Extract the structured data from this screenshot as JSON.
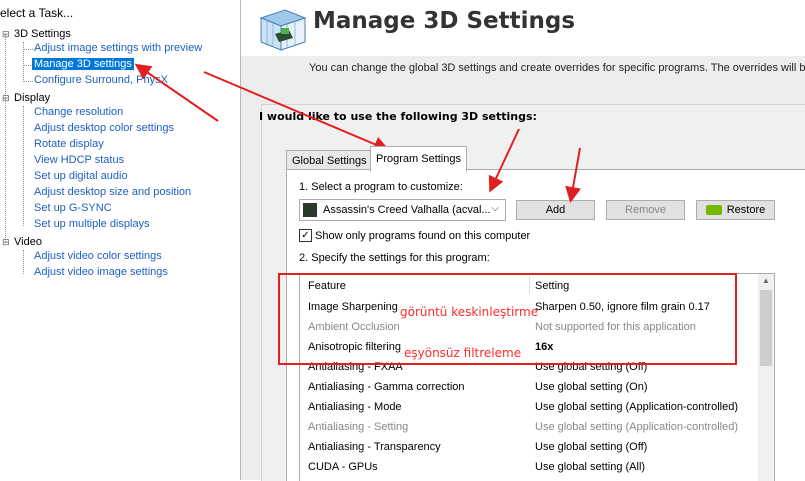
{
  "left_panel": {
    "task_title": "elect a Task...",
    "categories": [
      {
        "label": "3D Settings",
        "items": [
          "Adjust image settings with preview",
          "Manage 3D settings",
          "Configure Surround, PhysX"
        ]
      },
      {
        "label": "Display",
        "items": [
          "Change resolution",
          "Adjust desktop color settings",
          "Rotate display",
          "View HDCP status",
          "Set up digital audio",
          "Adjust desktop size and position",
          "Set up G-SYNC",
          "Set up multiple displays"
        ]
      },
      {
        "label": "Video",
        "items": [
          "Adjust video color settings",
          "Adjust video image settings"
        ]
      }
    ],
    "selected_item": "Manage 3D settings"
  },
  "header": {
    "title": "Manage 3D Settings",
    "description": "You can change the global 3D settings and create overrides for specific programs. The overrides will be u"
  },
  "panel": {
    "title": "I would like to use the following 3D settings:",
    "tabs": [
      "Global Settings",
      "Program Settings"
    ],
    "active_tab": "Program Settings",
    "step1_label": "1. Select a program to customize:",
    "program_value": "Assassin's Creed Valhalla (acval...",
    "add_label": "Add",
    "remove_label": "Remove",
    "restore_label": "Restore",
    "checkbox_label": "Show only programs found on this computer",
    "checkbox_checked": true,
    "step2_label": "2. Specify the settings for this program:",
    "columns": [
      "Feature",
      "Setting"
    ],
    "rows": [
      {
        "feature": "Image Sharpening",
        "setting": "Sharpen 0.50, ignore film grain 0.17",
        "dim": false,
        "bold": false
      },
      {
        "feature": "Ambient Occlusion",
        "setting": "Not supported for this application",
        "dim": true,
        "bold": false
      },
      {
        "feature": "Anisotropic filtering",
        "setting": "16x",
        "dim": false,
        "bold": true
      },
      {
        "feature": "Antialiasing - FXAA",
        "setting": "Use global setting (Off)",
        "dim": false,
        "bold": false
      },
      {
        "feature": "Antialiasing - Gamma correction",
        "setting": "Use global setting (On)",
        "dim": false,
        "bold": false
      },
      {
        "feature": "Antialiasing - Mode",
        "setting": "Use global setting (Application-controlled)",
        "dim": false,
        "bold": false
      },
      {
        "feature": "Antialiasing - Setting",
        "setting": "Use global setting (Application-controlled)",
        "dim": true,
        "bold": false
      },
      {
        "feature": "Antialiasing - Transparency",
        "setting": "Use global setting (Off)",
        "dim": false,
        "bold": false
      },
      {
        "feature": "CUDA - GPUs",
        "setting": "Use global setting (All)",
        "dim": false,
        "bold": false
      }
    ]
  },
  "annotations": {
    "sharpening_note": "görüntü keskinleştirme",
    "filtering_note": "eşyönsüz filtreleme",
    "color": "#e02020"
  },
  "colors": {
    "link": "#1f5fbf",
    "selection": "#0078d7",
    "nvidia_green": "#76b900"
  },
  "icons": {
    "app_logo": "3d-cube-logo-icon",
    "game": "game-icon",
    "restore": "nvidia-logo-icon",
    "dropdown": "chevron-down-icon",
    "tree_toggle": "minus-toggle-icon"
  }
}
